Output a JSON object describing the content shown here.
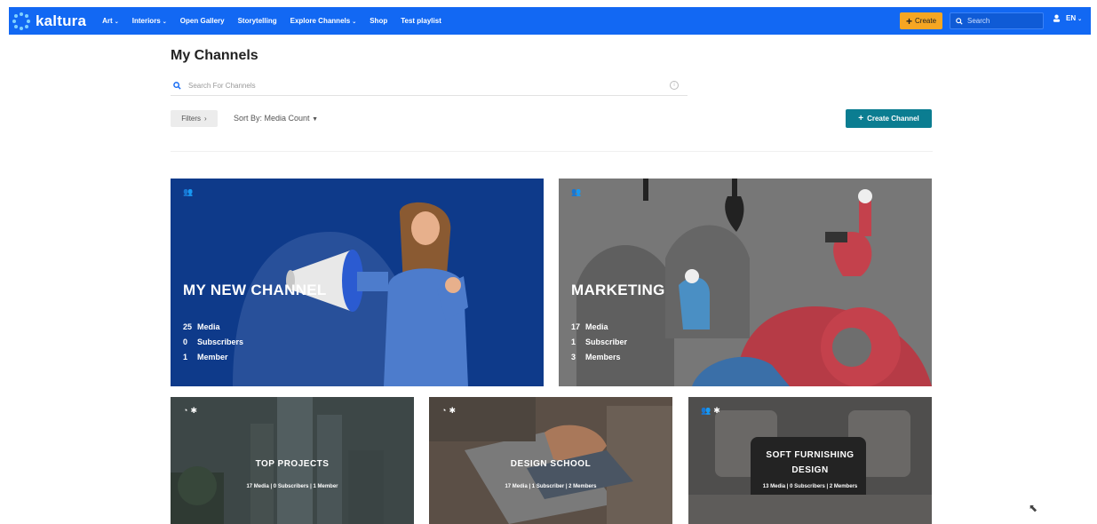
{
  "brand": {
    "name": "kaltura"
  },
  "nav": [
    {
      "label": "Art",
      "caret": "⌄"
    },
    {
      "label": "Interiors",
      "caret": "⌄"
    },
    {
      "label": "Open Gallery",
      "caret": ""
    },
    {
      "label": "Storytelling",
      "caret": ""
    },
    {
      "label": "Explore Channels",
      "caret": "⌄"
    },
    {
      "label": "Shop",
      "caret": ""
    },
    {
      "label": "Test playlist",
      "caret": ""
    }
  ],
  "header": {
    "create_label": "Create",
    "search_placeholder": "Search",
    "lang_label": "EN"
  },
  "page": {
    "title": "My Channels",
    "search_placeholder": "Search For Channels",
    "filters_label": "Filters",
    "sort_label": "Sort By: Media Count",
    "create_channel_label": "Create Channel"
  },
  "channels": [
    {
      "title": "MY NEW CHANNEL",
      "stats": [
        [
          "25",
          "Media"
        ],
        [
          "0",
          "Subscribers"
        ],
        [
          "1",
          "Member"
        ]
      ]
    },
    {
      "title": "MARKETING",
      "stats": [
        [
          "17",
          "Media"
        ],
        [
          "1",
          "Subscriber"
        ],
        [
          "3",
          "Members"
        ]
      ]
    },
    {
      "title": "TOP PROJECTS",
      "meta": "17 Media | 0 Subscribers | 1 Member"
    },
    {
      "title": "DESIGN SCHOOL",
      "meta": "17 Media | 1 Subscriber | 2 Members"
    },
    {
      "title_line1": "SOFT FURNISHING",
      "title_line2": "DESIGN",
      "meta": "13 Media | 0 Subscribers | 2 Members"
    }
  ],
  "colors": {
    "topbar": "#1268f3",
    "create": "#f5a623",
    "create_channel": "#0b7d91"
  },
  "icons": [
    "kaltura-logo-icon",
    "search-icon",
    "user-icon",
    "group-icon",
    "globe-icon",
    "star-icon",
    "mouse-cursor-icon"
  ]
}
